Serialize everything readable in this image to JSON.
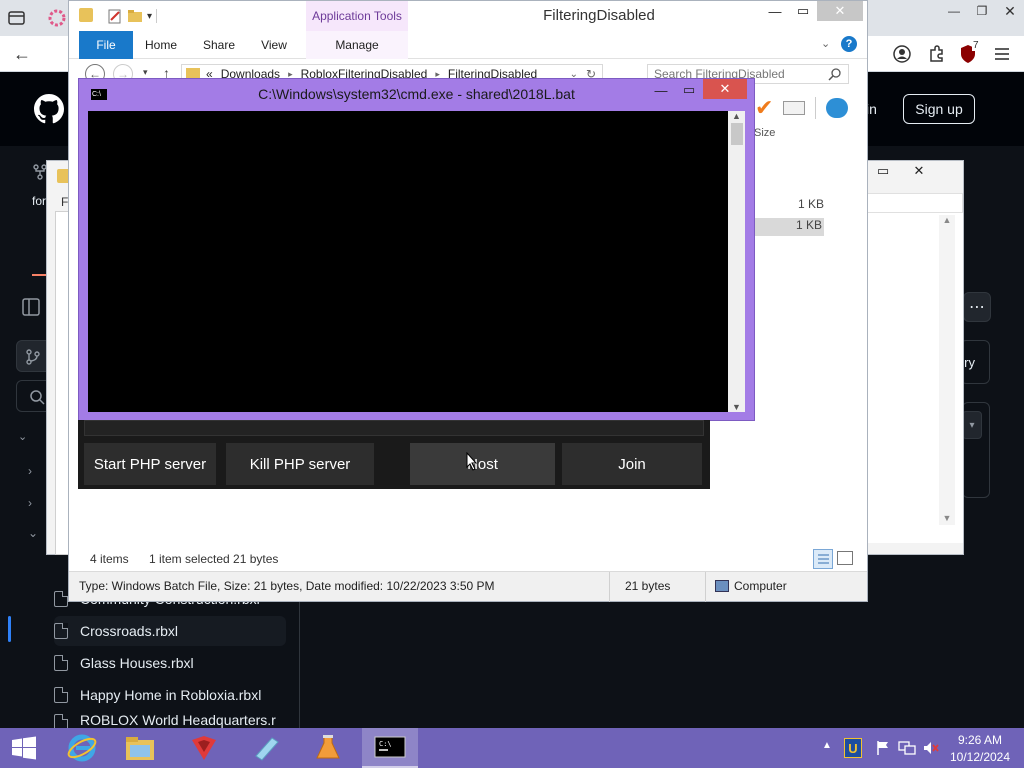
{
  "browser": {
    "nav_back": "←",
    "extension_badge": "7"
  },
  "github": {
    "sign_in": "in",
    "sign_up": "Sign up",
    "side_fork_label": "for",
    "partial_right_label": "ry",
    "files": [
      {
        "name": "Community Construction.rbxl",
        "selected": false
      },
      {
        "name": "Crossroads.rbxl",
        "selected": true
      },
      {
        "name": "Glass Houses.rbxl",
        "selected": false
      },
      {
        "name": "Happy Home in Robloxia.rbxl",
        "selected": false
      },
      {
        "name": "ROBLOX World Headquarters.r",
        "selected": false
      }
    ]
  },
  "explorer": {
    "title": "FilteringDisabled",
    "context_tab": "Application Tools",
    "ribbon_tabs": [
      "File",
      "Home",
      "Share",
      "View",
      "Manage"
    ],
    "breadcrumb": [
      "Downloads",
      "RobloxFilteringDisabled",
      "FilteringDisabled"
    ],
    "breadcrumb_prefix": "«",
    "search_placeholder": "Search FilteringDisabled",
    "column_size": "Size",
    "sizes": [
      "1 KB",
      "1 KB"
    ],
    "status_items": "4 items",
    "status_selected": "1 item selected  21 bytes",
    "details_type": "Type: Windows Batch File, Size: 21 bytes, Date modified: 10/22/2023 3:50 PM",
    "details_size": "21 bytes",
    "details_location": "Computer"
  },
  "explorer_back": {
    "menu_label": "F"
  },
  "cmd": {
    "title": "C:\\Windows\\system32\\cmd.exe - shared\\2018L.bat",
    "icon_text": "C:\\"
  },
  "app": {
    "buttons": [
      "Start PHP server",
      "Kill PHP server",
      "Host",
      "Join"
    ]
  },
  "taskbar": {
    "time": "9:26 AM",
    "date": "10/12/2024",
    "icons": [
      "start-icon",
      "internet-explorer-icon",
      "file-explorer-icon",
      "roblox-studio-icon",
      "paint-icon",
      "flask-icon",
      "cmd-icon"
    ]
  },
  "colors": {
    "cmd_accent": "#a37ce6",
    "taskbar": "#6f63b8",
    "github_bg": "#0d1117",
    "file_tab_blue": "#1979ca"
  }
}
